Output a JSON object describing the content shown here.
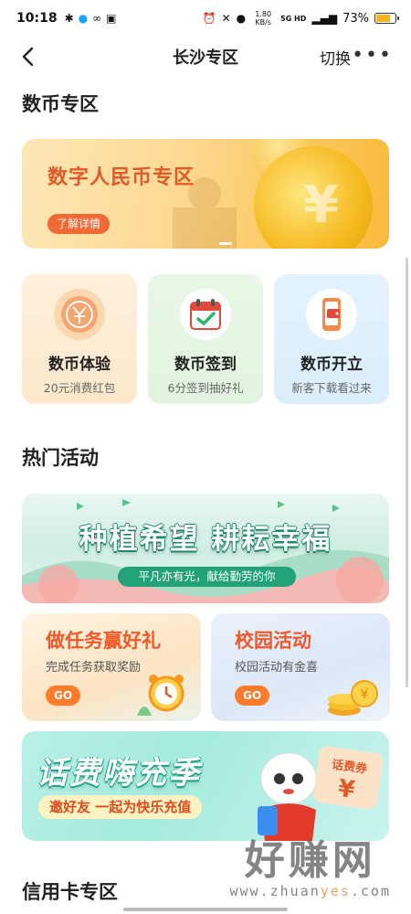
{
  "status_bar": {
    "time": "10:18",
    "net_speed": "1.80 KB/s",
    "network": "5G HD",
    "battery_percent": "73%",
    "battery_level": 0.73
  },
  "nav": {
    "title": "长沙专区",
    "switch_label": "切换",
    "more_icon": "more-icon"
  },
  "section_digital": {
    "title": "数币专区",
    "banner": {
      "title": "数字人民币专区",
      "button": "了解详情"
    },
    "cards": [
      {
        "name": "数币体验",
        "sub": "20元消费红包",
        "icon": "yuan-coin-icon"
      },
      {
        "name": "数币签到",
        "sub": "6分签到抽好礼",
        "icon": "calendar-check-icon"
      },
      {
        "name": "数币开立",
        "sub": "新客下载看过来",
        "icon": "phone-wallet-icon"
      }
    ]
  },
  "section_hot": {
    "title": "热门活动",
    "banner": {
      "title": "种植希望 耕耘幸福",
      "subtitle": "平凡亦有光，献给勤劳的你"
    },
    "promos": [
      {
        "title": "做任务赢好礼",
        "sub": "完成任务获取奖励",
        "button": "GO"
      },
      {
        "title": "校园活动",
        "sub": "校园活动有金喜",
        "button": "GO"
      }
    ],
    "banner3": {
      "title": "话费嗨充季",
      "subtitle": "邀好友 一起为快乐充值",
      "voucher": "话费券"
    }
  },
  "section_credit": {
    "title": "信用卡专区"
  },
  "watermark": {
    "big": "好赚网",
    "small_pre": "www.zhuan",
    "small_hl": "yes",
    "small_post": ".com"
  },
  "colors": {
    "accent_orange": "#f05a2a",
    "go_button": "#ff7b2c",
    "green_banner": "#23a27a"
  }
}
